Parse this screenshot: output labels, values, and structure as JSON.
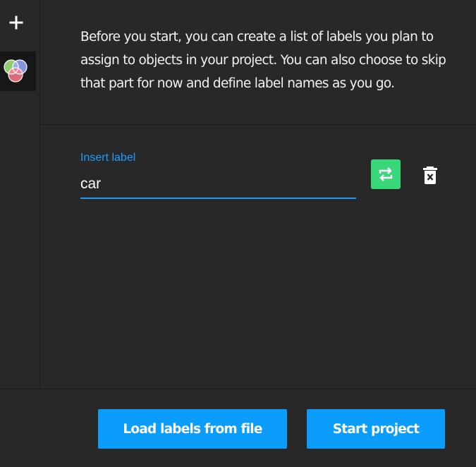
{
  "sidebar": {
    "add_icon": "plus-icon",
    "project_icon": "color-circles-icon"
  },
  "intro": {
    "text": "Before you start, you can create a list of labels you plan to assign to objects in your project. You can also choose to skip that part for now and define label names as you go."
  },
  "label_editor": {
    "field_label": "Insert label",
    "value": "car",
    "change_color_icon": "repeat-icon",
    "change_color_color": "#3ad77a",
    "delete_icon": "trash-x-icon"
  },
  "footer": {
    "load_button": "Load labels from file",
    "start_button": "Start project"
  },
  "colors": {
    "background": "#282828",
    "accent": "#0a9dfc",
    "input_accent": "#1e9bff"
  }
}
